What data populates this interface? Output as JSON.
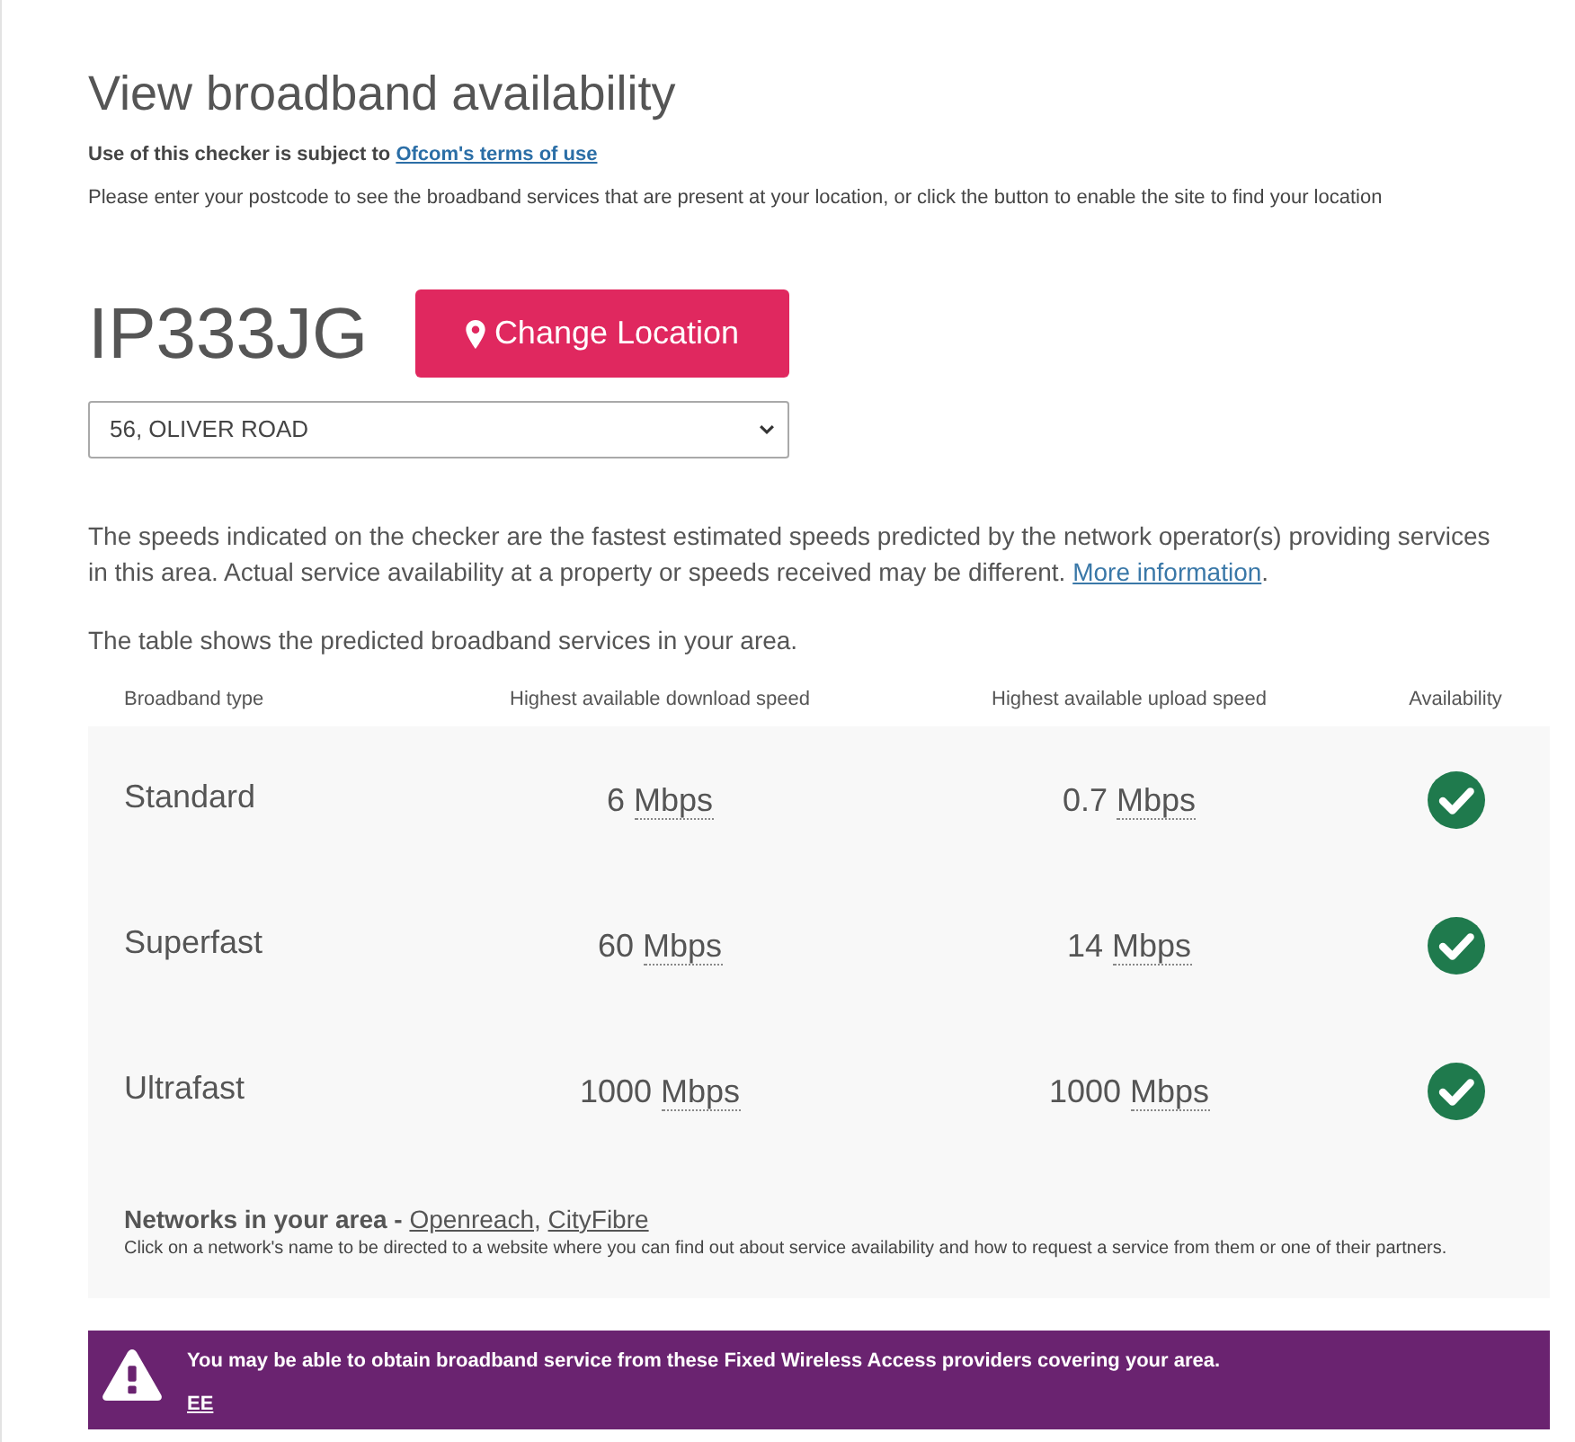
{
  "page": {
    "title": "View broadband availability",
    "terms": {
      "text": "Use of this checker is subject to",
      "link": "Ofcom's terms of use"
    },
    "intro": "Please enter your postcode to see the broadband services that are present at your location, or click the button to enable the site to find your location"
  },
  "location": {
    "postcode": "IP333JG",
    "button": "Change Location",
    "address_select": {
      "value": "56, OLIVER ROAD"
    }
  },
  "disclaimer": {
    "text": "The speeds indicated on the checker are the fastest estimated speeds predicted by the network operator(s) providing services in this area. Actual service availability at a property or speeds received may be different.",
    "link": "More information",
    "text_after": "."
  },
  "table_intro": "The table shows the predicted broadband services in your area.",
  "table": {
    "columns": [
      "Broadband type",
      "Highest available download speed",
      "Highest available upload speed",
      "Availability"
    ],
    "rows": [
      {
        "type": "Standard",
        "download": {
          "value": "6",
          "unit": "Mbps"
        },
        "upload": {
          "value": "0.7",
          "unit": "Mbps"
        },
        "available": true
      },
      {
        "type": "Superfast",
        "download": {
          "value": "60",
          "unit": "Mbps"
        },
        "upload": {
          "value": "14",
          "unit": "Mbps"
        },
        "available": true
      },
      {
        "type": "Ultrafast",
        "download": {
          "value": "1000",
          "unit": "Mbps"
        },
        "upload": {
          "value": "1000",
          "unit": "Mbps"
        },
        "available": true
      }
    ]
  },
  "networks": {
    "label": "Networks in your area -",
    "separator": ",",
    "links": [
      "Openreach",
      "CityFibre"
    ],
    "note": "Click on a network's name to be directed to a website where you can find out about service availability and how to request a service from them or one of their partners."
  },
  "wireless_alert": {
    "message": "You may be able to obtain broadband service from these Fixed Wireless Access providers covering your area.",
    "providers": [
      "EE"
    ]
  }
}
